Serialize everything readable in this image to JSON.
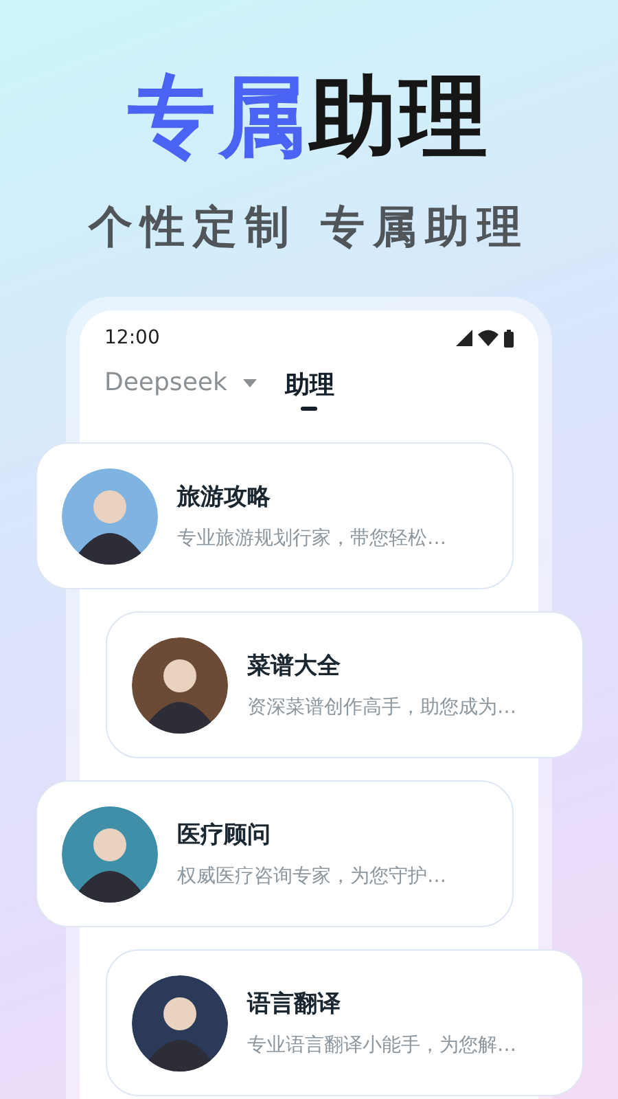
{
  "headline": {
    "highlight": "专属",
    "rest": "助理"
  },
  "subtitle": "个性定制 专属助理",
  "status_bar": {
    "time": "12:00"
  },
  "tabs": [
    {
      "label": "Deepseek",
      "selected": false,
      "dropdown": true
    },
    {
      "label": "助理",
      "selected": true,
      "dropdown": false
    }
  ],
  "assistants": [
    {
      "title": "旅游攻略",
      "description": "专业旅游规划行家，带您轻松…"
    },
    {
      "title": "菜谱大全",
      "description": "资深菜谱创作高手，助您成为…"
    },
    {
      "title": "医疗顾问",
      "description": "权威医疗咨询专家，为您守护…"
    },
    {
      "title": "语言翻译",
      "description": "专业语言翻译小能手，为您解…"
    }
  ]
}
